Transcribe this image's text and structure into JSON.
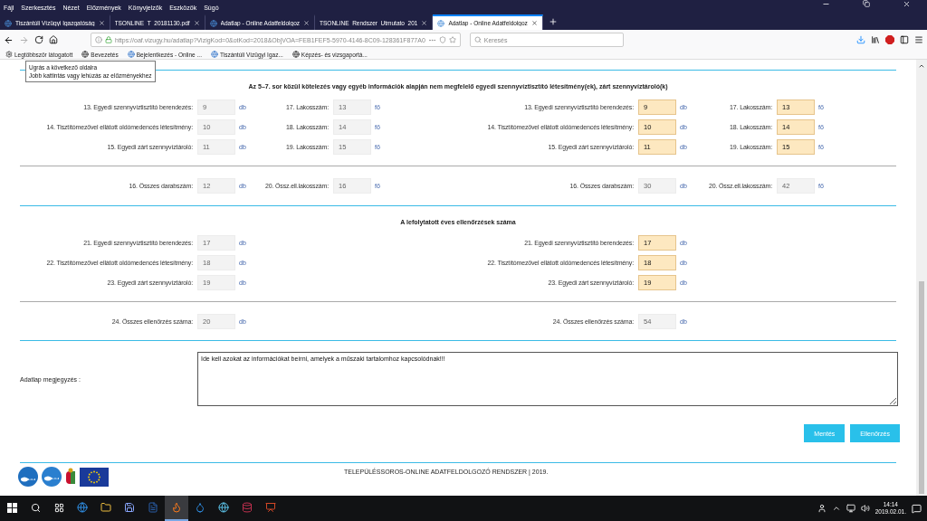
{
  "menu": [
    "Fájl",
    "Szerkesztés",
    "Nézet",
    "Előzmények",
    "Könyvjelzők",
    "Eszközök",
    "Súgó"
  ],
  "tabs": [
    {
      "title": "Tiszántúli Vízügyi Igazgatóság",
      "kind": "site",
      "selected": false
    },
    {
      "title": "TSONLINE_T_20181130.pdf",
      "kind": "doc",
      "selected": false
    },
    {
      "title": "Adatlap - Online Adatfeldolgoz",
      "kind": "site",
      "selected": false
    },
    {
      "title": "TSONLINE_Rendszer_Utmutato_201",
      "kind": "doc",
      "selected": false
    },
    {
      "title": "Adatlap - Online Adatfeldolgoz",
      "kind": "site",
      "selected": true
    }
  ],
  "address": {
    "url": "https://oaf.vizugy.hu/adatlap?VizigKod=0&otKod=2018&ObjVOA=FEB1FEF5-5970-4146-8C09-128361F877A0"
  },
  "search": {
    "placeholder": "Keresés"
  },
  "bookmarks": [
    {
      "label": "Legtöbbször látogatott",
      "kind": "gear"
    },
    {
      "label": "Bevezetés",
      "kind": "globe"
    },
    {
      "label": "Bejelentkezés - Online ...",
      "kind": "site"
    },
    {
      "label": "Tiszántúli Vízügyi Igaz...",
      "kind": "site"
    },
    {
      "label": "Képzés- és vizsgaportá...",
      "kind": "globe"
    }
  ],
  "tooltip": {
    "lines": [
      "Ugrás a következő oldalra",
      "Jobb kattintás vagy lehúzás az előzményekhez"
    ]
  },
  "sections": [
    {
      "heading": "Az 5–7. sor közül kötelezés vagy egyéb információk alapján nem megfelelő egyedi szennyvíztisztító létesítmény(ek), zárt szennyvíztároló(k)",
      "rows": [
        {
          "left": [
            {
              "label": "13. Egyedi szennyvíztisztító berendezés:",
              "value": "9",
              "unit": "db",
              "editable": false
            },
            {
              "label": "17. Lakosszám:",
              "value": "13",
              "unit": "fő",
              "editable": false
            }
          ],
          "right": [
            {
              "label": "13. Egyedi szennyvíztisztító berendezés:",
              "value": "9",
              "unit": "db",
              "editable": true
            },
            {
              "label": "17. Lakosszám:",
              "value": "13",
              "unit": "fő",
              "editable": true
            }
          ]
        },
        {
          "left": [
            {
              "label": "14. Tisztítómezővel ellátott oldómedencés létesítmény:",
              "value": "10",
              "unit": "db",
              "editable": false
            },
            {
              "label": "18. Lakosszám:",
              "value": "14",
              "unit": "fő",
              "editable": false
            }
          ],
          "right": [
            {
              "label": "14. Tisztítómezővel ellátott oldómedencés létesítmény:",
              "value": "10",
              "unit": "db",
              "editable": true
            },
            {
              "label": "18. Lakosszám:",
              "value": "14",
              "unit": "fő",
              "editable": true
            }
          ]
        },
        {
          "left": [
            {
              "label": "15. Egyedi zárt szennyvíztároló:",
              "value": "11",
              "unit": "db",
              "editable": false
            },
            {
              "label": "19. Lakosszám:",
              "value": "15",
              "unit": "fő",
              "editable": false
            }
          ],
          "right": [
            {
              "label": "15. Egyedi zárt szennyvíztároló:",
              "value": "11",
              "unit": "db",
              "editable": true
            },
            {
              "label": "19. Lakosszám:",
              "value": "15",
              "unit": "fő",
              "editable": true
            }
          ]
        }
      ],
      "totals": {
        "left": [
          {
            "label": "16. Összes darabszám:",
            "value": "12",
            "unit": "db",
            "editable": false
          },
          {
            "label": "20. Össz.ell.lakosszám:",
            "value": "16",
            "unit": "fő",
            "editable": false
          }
        ],
        "right": [
          {
            "label": "16. Összes darabszám:",
            "value": "30",
            "unit": "db",
            "editable": false
          },
          {
            "label": "20. Össz.ell.lakosszám:",
            "value": "42",
            "unit": "fő",
            "editable": false
          }
        ]
      }
    },
    {
      "heading": "A lefolytatott éves ellenőrzések száma",
      "rows": [
        {
          "left": [
            {
              "label": "21. Egyedi szennyvíztisztító berendezés:",
              "value": "17",
              "unit": "db",
              "editable": false
            }
          ],
          "right": [
            {
              "label": "21. Egyedi szennyvíztisztító berendezés:",
              "value": "17",
              "unit": "db",
              "editable": true
            }
          ]
        },
        {
          "left": [
            {
              "label": "22. Tisztítómezővel ellátott oldómedencés létesítmény:",
              "value": "18",
              "unit": "db",
              "editable": false
            }
          ],
          "right": [
            {
              "label": "22. Tisztítómezővel ellátott oldómedencés létesítmény:",
              "value": "18",
              "unit": "db",
              "editable": true
            }
          ]
        },
        {
          "left": [
            {
              "label": "23. Egyedi zárt szennyvíztároló:",
              "value": "19",
              "unit": "db",
              "editable": false
            }
          ],
          "right": [
            {
              "label": "23. Egyedi zárt szennyvíztároló:",
              "value": "19",
              "unit": "db",
              "editable": true
            }
          ]
        }
      ],
      "totals": {
        "left": [
          {
            "label": "24. Összes ellenőrzés száma:",
            "value": "20",
            "unit": "db",
            "editable": false
          }
        ],
        "right": [
          {
            "label": "24. Összes ellenőrzés száma:",
            "value": "54",
            "unit": "db",
            "editable": false
          }
        ]
      }
    }
  ],
  "note": {
    "label": "Adatlap megjegyzés :",
    "value": "Ide kell azokat az információkat beírni, amelyek a műszaki tartalomhoz kapcsolódnak!!!"
  },
  "buttons": [
    "Mentés",
    "Ellenőrzés"
  ],
  "footer": {
    "text": "TELEPÜLÉSSOROS-ONLINE ADATFELDOLGOZÓ RENDSZER | 2019."
  },
  "taskbar": {
    "apps": [
      {
        "kind": "edge",
        "active": false
      },
      {
        "kind": "folder",
        "active": false
      },
      {
        "kind": "save",
        "active": false
      },
      {
        "kind": "word",
        "active": false
      },
      {
        "kind": "firefox",
        "active": true
      },
      {
        "kind": "drop",
        "active": false
      },
      {
        "kind": "globe",
        "active": false
      },
      {
        "kind": "access",
        "active": false
      },
      {
        "kind": "powerpoint",
        "active": false
      }
    ],
    "time": "14:14",
    "date": "2019.02.01."
  }
}
